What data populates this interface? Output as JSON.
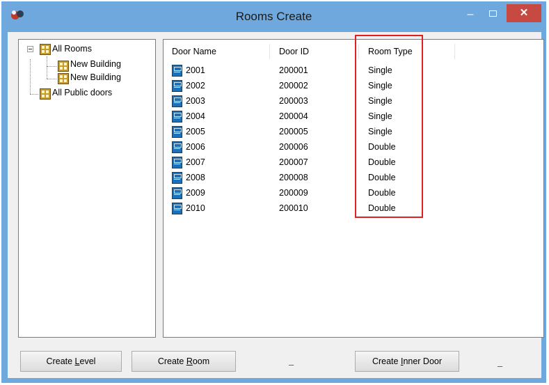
{
  "window": {
    "title": "Rooms Create",
    "minimize": "–",
    "close": "✕"
  },
  "tree": {
    "root": "All Rooms",
    "children": [
      "New Building",
      "New Building"
    ],
    "public": "All Public doors"
  },
  "list": {
    "headers": {
      "name": "Door Name",
      "id": "Door ID",
      "type": "Room Type"
    },
    "rows": [
      {
        "name": "2001",
        "id": "200001",
        "type": "Single"
      },
      {
        "name": "2002",
        "id": "200002",
        "type": "Single"
      },
      {
        "name": "2003",
        "id": "200003",
        "type": "Single"
      },
      {
        "name": "2004",
        "id": "200004",
        "type": "Single"
      },
      {
        "name": "2005",
        "id": "200005",
        "type": "Single"
      },
      {
        "name": "2006",
        "id": "200006",
        "type": "Double"
      },
      {
        "name": "2007",
        "id": "200007",
        "type": "Double"
      },
      {
        "name": "2008",
        "id": "200008",
        "type": "Double"
      },
      {
        "name": "2009",
        "id": "200009",
        "type": "Double"
      },
      {
        "name": "2010",
        "id": "200010",
        "type": "Double"
      }
    ]
  },
  "buttons": {
    "create_level": {
      "pre": "Create ",
      "key": "L",
      "post": "evel"
    },
    "create_room": {
      "pre": "Create ",
      "key": "R",
      "post": "oom"
    },
    "create_inner_door": {
      "pre": "Create ",
      "key": "I",
      "post": "nner Door"
    }
  },
  "dashes": [
    "–",
    "–"
  ],
  "colors": {
    "titlebar": "#6fa8dc",
    "close": "#c74a42",
    "highlight": "#e02020"
  }
}
